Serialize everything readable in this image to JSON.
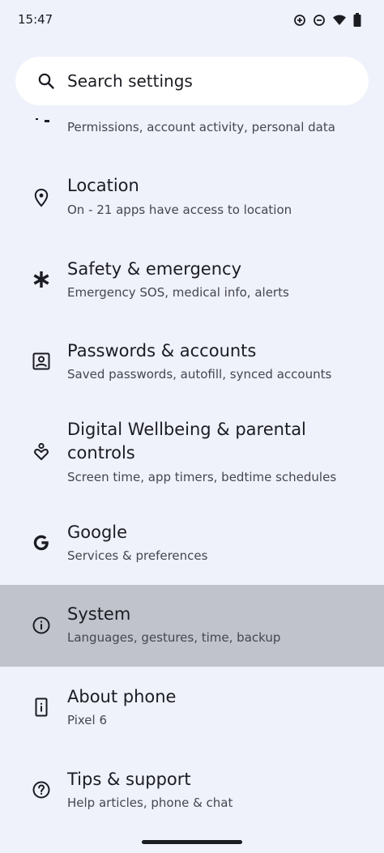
{
  "status_bar": {
    "time": "15:47"
  },
  "search": {
    "placeholder": "Search settings"
  },
  "partial_item": {
    "subtitle": "Permissions, account activity, personal data"
  },
  "items": [
    {
      "title": "Location",
      "subtitle": "On - 21 apps have access to location",
      "icon": "location-pin-icon"
    },
    {
      "title": "Safety & emergency",
      "subtitle": "Emergency SOS, medical info, alerts",
      "icon": "asterisk-icon"
    },
    {
      "title": "Passwords & accounts",
      "subtitle": "Saved passwords, autofill, synced accounts",
      "icon": "account-box-icon"
    },
    {
      "title": "Digital Wellbeing & parental controls",
      "subtitle": "Screen time, app timers, bedtime schedules",
      "icon": "wellbeing-icon"
    },
    {
      "title": "Google",
      "subtitle": "Services & preferences",
      "icon": "google-icon"
    },
    {
      "title": "System",
      "subtitle": "Languages, gestures, time, backup",
      "icon": "info-icon"
    },
    {
      "title": "About phone",
      "subtitle": "Pixel 6",
      "icon": "phone-info-icon"
    },
    {
      "title": "Tips & support",
      "subtitle": "Help articles, phone & chat",
      "icon": "help-icon"
    }
  ],
  "colors": {
    "background": "#eff1fb",
    "highlight": "#c0c3cb",
    "text_primary": "#1b1c22",
    "text_secondary": "#45464f"
  }
}
